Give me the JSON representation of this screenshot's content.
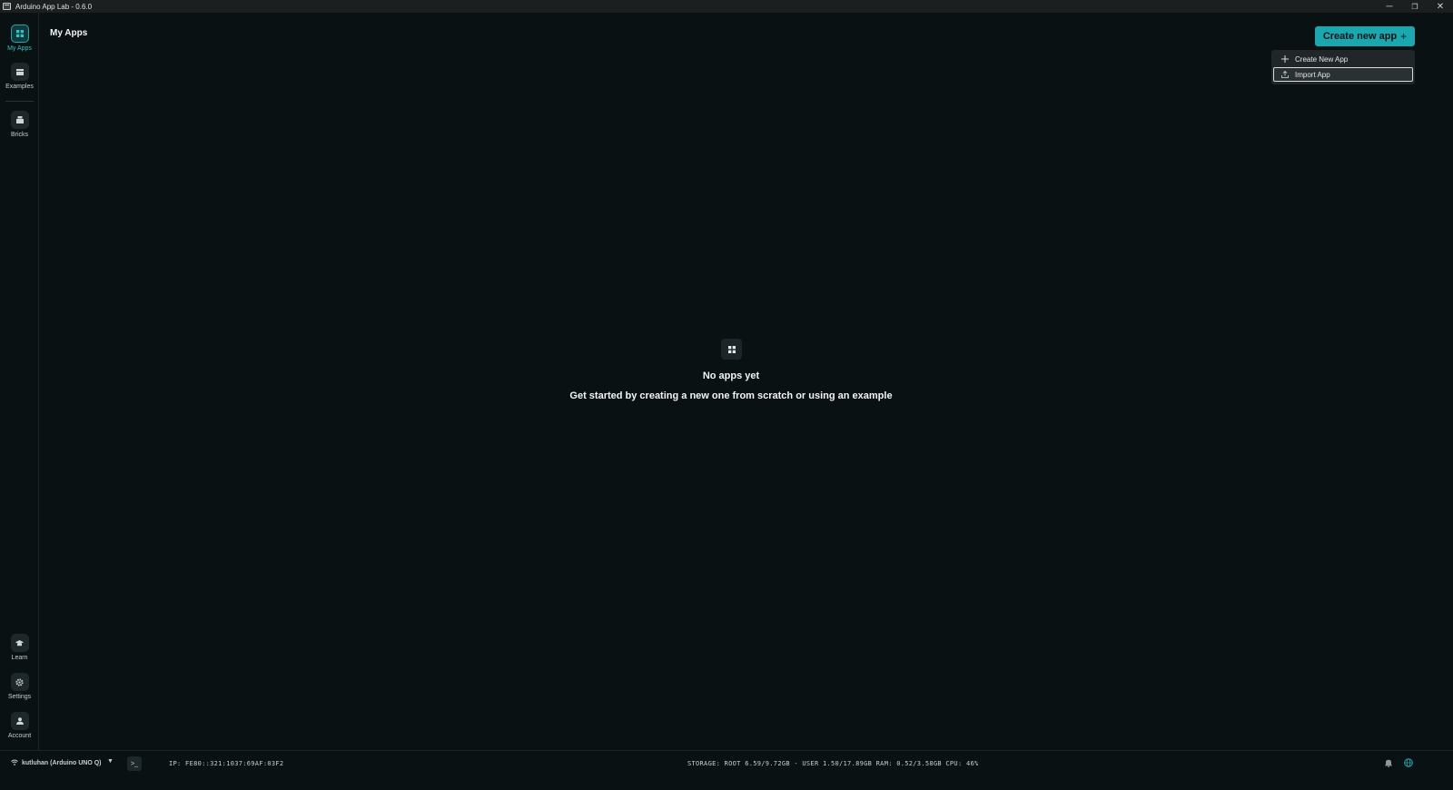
{
  "window": {
    "title": "Arduino App Lab - 0.6.0",
    "controls": {
      "minimize": "─",
      "restore": "❐",
      "close": "✕"
    }
  },
  "sidebar": {
    "items": [
      {
        "label": "My Apps",
        "icon": "grid-icon",
        "active": true
      },
      {
        "label": "Examples",
        "icon": "examples-icon",
        "active": false
      },
      {
        "label": "Bricks",
        "icon": "bricks-icon",
        "active": false
      }
    ],
    "bottom_items": [
      {
        "label": "Learn",
        "icon": "graduation-cap-icon"
      },
      {
        "label": "Settings",
        "icon": "gear-icon"
      },
      {
        "label": "Account",
        "icon": "user-icon"
      }
    ]
  },
  "main": {
    "page_title": "My Apps",
    "create_button": {
      "label": "Create new app",
      "icon": "+"
    },
    "dropdown": {
      "items": [
        {
          "label": "Create New App",
          "icon": "plus-icon"
        },
        {
          "label": "Import App",
          "icon": "upload-icon",
          "focused": true
        }
      ]
    },
    "empty_state": {
      "icon": "grid-icon",
      "title": "No apps yet",
      "subtitle": "Get started by creating a new one from scratch or using an example"
    }
  },
  "statusbar": {
    "device": "kutluhan (Arduino UNO Q)",
    "ip": "IP: FE80::321:1037:69AF:03F2",
    "stats": "STORAGE: ROOT 6.59/9.72GB - USER 1.50/17.89GB  RAM: 0.52/3.58GB  CPU: 46%"
  },
  "colors": {
    "accent": "#1aa7b0",
    "background": "#0a1113",
    "active_nav": "#2fc5c2"
  }
}
